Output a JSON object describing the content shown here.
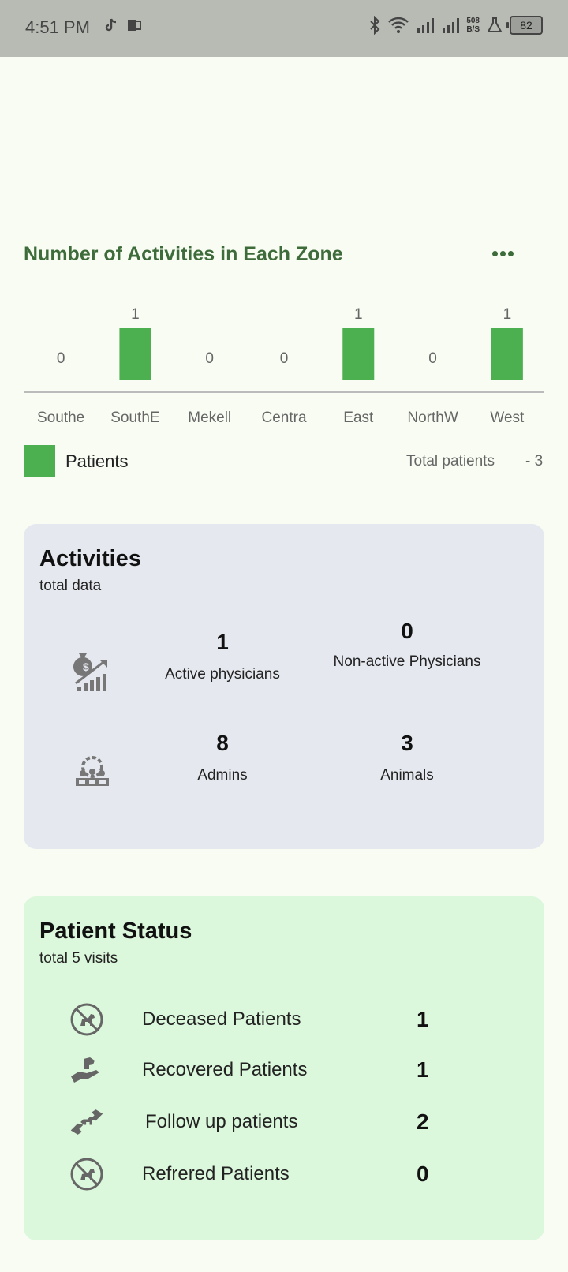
{
  "statusbar": {
    "time": "4:51 PM",
    "speed_value": "508",
    "speed_unit": "B/S",
    "battery": "82"
  },
  "chart_section": {
    "title": "Number of Activities in Each Zone",
    "legend_label": "Patients",
    "total_label": "Total patients",
    "total_value": "- 3"
  },
  "chart_data": {
    "type": "bar",
    "categories": [
      "Southe",
      "SouthE",
      "Mekell",
      "Centra",
      "East",
      "NorthW",
      "West"
    ],
    "values": [
      0,
      1,
      0,
      0,
      1,
      0,
      1
    ],
    "series": [
      {
        "name": "Patients",
        "values": [
          0,
          1,
          0,
          0,
          1,
          0,
          1
        ]
      }
    ],
    "color": "#4caf50",
    "ylim": [
      0,
      1
    ],
    "grid": false,
    "legend": "bottom-left"
  },
  "activities": {
    "title": "Activities",
    "subtitle": "total data",
    "stats": [
      {
        "value": "1",
        "label": "Active physicians"
      },
      {
        "value": "0",
        "label": "Non-active Physicians"
      },
      {
        "value": "8",
        "label": "Admins"
      },
      {
        "value": "3",
        "label": "Animals"
      }
    ],
    "icons": [
      "money-growth-icon",
      "team-gear-icon"
    ]
  },
  "patient_status": {
    "title": "Patient Status",
    "subtitle": "total 5 visits",
    "rows": [
      {
        "label": "Deceased Patients",
        "count": "1",
        "icon": "no-dog-icon"
      },
      {
        "label": "Recovered Patients",
        "count": "1",
        "icon": "hand-dog-icon"
      },
      {
        "label": "Follow up patients",
        "count": "2",
        "icon": "hands-pet-icon"
      },
      {
        "label": "Refrered Patients",
        "count": "0",
        "icon": "no-dog-icon"
      }
    ]
  },
  "colors": {
    "accent": "#3e6b3a",
    "bar": "#4caf50",
    "activities_card": "#e5e9ef",
    "status_card": "#dcf8dc",
    "background": "#f8fcf3"
  }
}
